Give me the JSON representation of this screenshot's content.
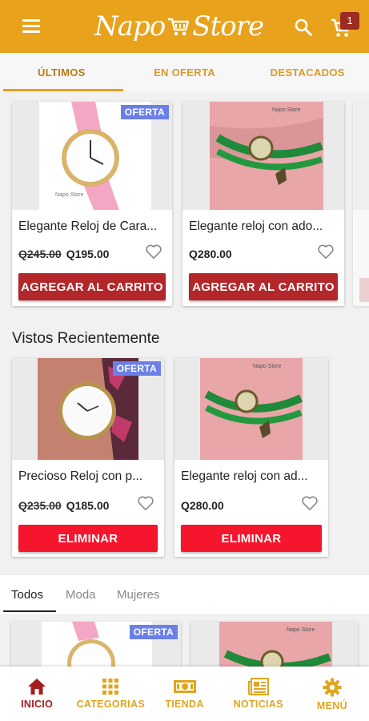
{
  "header": {
    "logo_left": "Napo",
    "logo_right": "Store",
    "cart_count": "1"
  },
  "tabs": [
    {
      "label": "ÚLTIMOS"
    },
    {
      "label": "EN OFERTA"
    },
    {
      "label": "DESTACADOS"
    }
  ],
  "latest": [
    {
      "name": "Elegante Reloj de Cara...",
      "old_price": "Q245.00",
      "price": "Q195.00",
      "badge": "OFERTA",
      "button": "AGREGAR AL CARRITO"
    },
    {
      "name": "Elegante reloj con ado...",
      "old_price": "",
      "price": "Q280.00",
      "badge": "",
      "button": "AGREGAR AL CARRITO"
    }
  ],
  "recent_title": "Vistos Recientemente",
  "recent": [
    {
      "name": "Precioso Reloj con p...",
      "old_price": "Q235.00",
      "price": "Q185.00",
      "badge": "OFERTA",
      "button": "ELIMINAR"
    },
    {
      "name": "Elegante reloj con ad...",
      "old_price": "",
      "price": "Q280.00",
      "badge": "",
      "button": "ELIMINAR"
    }
  ],
  "filters": [
    {
      "label": "Todos"
    },
    {
      "label": "Moda"
    },
    {
      "label": "Mujeres"
    }
  ],
  "bottom_grid": [
    {
      "badge": "OFERTA"
    }
  ],
  "bottom_nav": [
    {
      "label": "INICIO",
      "icon": "home-icon"
    },
    {
      "label": "CATEGORIAS",
      "icon": "grid-icon"
    },
    {
      "label": "TIENDA",
      "icon": "store-icon"
    },
    {
      "label": "NOTICIAS",
      "icon": "news-icon"
    },
    {
      "label": "MENÚ",
      "icon": "gear-icon"
    }
  ],
  "colors": {
    "brand": "#e8a21b",
    "add_button": "#b3262a",
    "remove_button": "#f5152d",
    "offer_badge": "#6b7fe8",
    "badge_dark": "#9c2b22"
  }
}
